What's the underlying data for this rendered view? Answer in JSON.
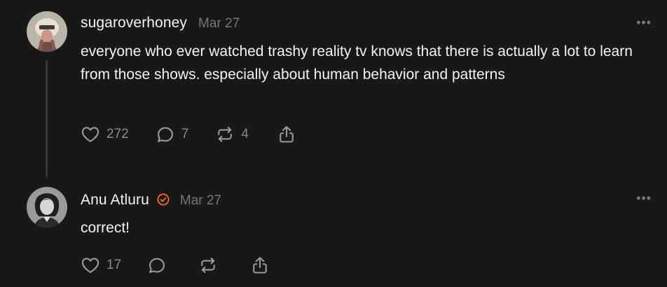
{
  "posts": [
    {
      "username": "sugaroverhoney",
      "date": "Mar 27",
      "more": "•••",
      "text": "everyone who ever watched trashy reality tv knows that there is actually a lot to learn from those shows. especially about human behavior and patterns",
      "likes": "272",
      "replies": "7",
      "reposts": "4"
    },
    {
      "username": "Anu Atluru",
      "verified": true,
      "date": "Mar 27",
      "more": "•••",
      "text": "correct!",
      "likes": "17"
    }
  ],
  "colors": {
    "background": "#181818",
    "text": "#f3f3f3",
    "muted": "#777777",
    "verified": "#ff6b1a"
  },
  "icons": [
    "heart-icon",
    "comment-icon",
    "repost-icon",
    "share-icon",
    "more-icon",
    "verified-icon"
  ]
}
